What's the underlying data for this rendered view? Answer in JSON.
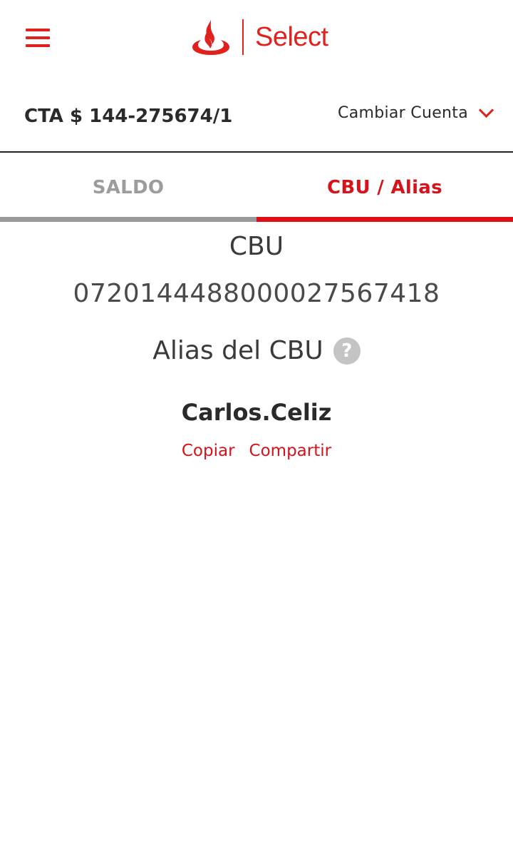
{
  "header": {
    "brand_label": "Select",
    "menu_icon": "hamburger-menu-icon",
    "logo_icon": "santander-flame-logo",
    "accent_color": "#e0221f"
  },
  "account": {
    "number": "CTA $ 144-275674/1",
    "change_label": "Cambiar Cuenta"
  },
  "tabs": [
    {
      "label": "SALDO",
      "active": false
    },
    {
      "label": "CBU / Alias",
      "active": true
    }
  ],
  "cbu": {
    "title": "CBU",
    "number": "0720144488000027567418",
    "alias_title": "Alias del CBU",
    "help_glyph": "?",
    "alias_value": "Carlos.Celiz"
  },
  "actions": {
    "copy_label": "Copiar",
    "share_label": "Compartir"
  }
}
